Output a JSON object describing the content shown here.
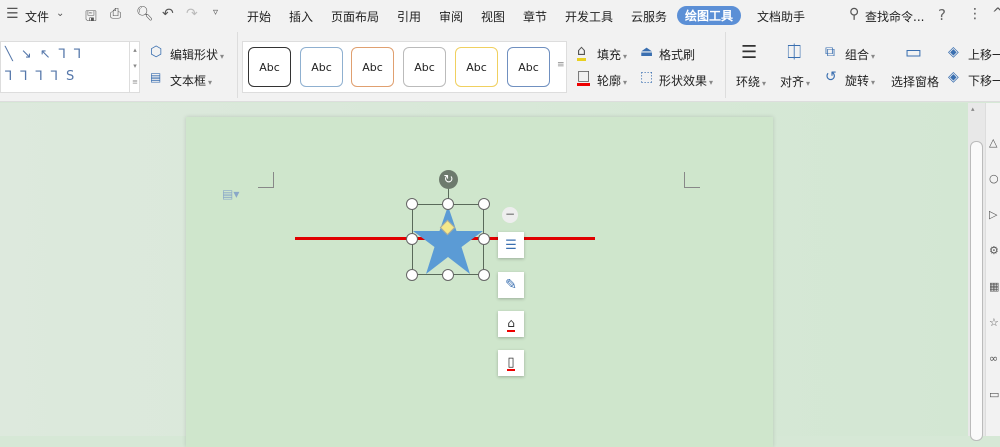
{
  "topbar": {
    "menu_label": "文件",
    "tabs": [
      "开始",
      "插入",
      "页面布局",
      "引用",
      "审阅",
      "视图",
      "章节",
      "开发工具",
      "云服务",
      "绘图工具",
      "文档助手"
    ],
    "active_tab": "绘图工具",
    "search": "查找命令...",
    "help": "?"
  },
  "ribbon": {
    "edit_shape": "编辑形状",
    "text_box": "文本框",
    "style_samples": [
      "Abc",
      "Abc",
      "Abc",
      "Abc",
      "Abc",
      "Abc"
    ],
    "style_colors": [
      "#333333",
      "#8fb0d0",
      "#e0a070",
      "#bbbbbb",
      "#f0d060",
      "#7090c0"
    ],
    "fill": "填充",
    "format_painter": "格式刷",
    "outline": "轮廓",
    "shape_effects": "形状效果",
    "wrap": "环绕",
    "align": "对齐",
    "group": "组合",
    "rotate": "旋转",
    "selection_pane": "选择窗格",
    "bring_forward": "上移一",
    "send_backward": "下移一"
  },
  "colors": {
    "accent": "#5b8fd6",
    "star": "#5b9bd5",
    "line": "#e00000",
    "page": "#cfe6cc"
  }
}
